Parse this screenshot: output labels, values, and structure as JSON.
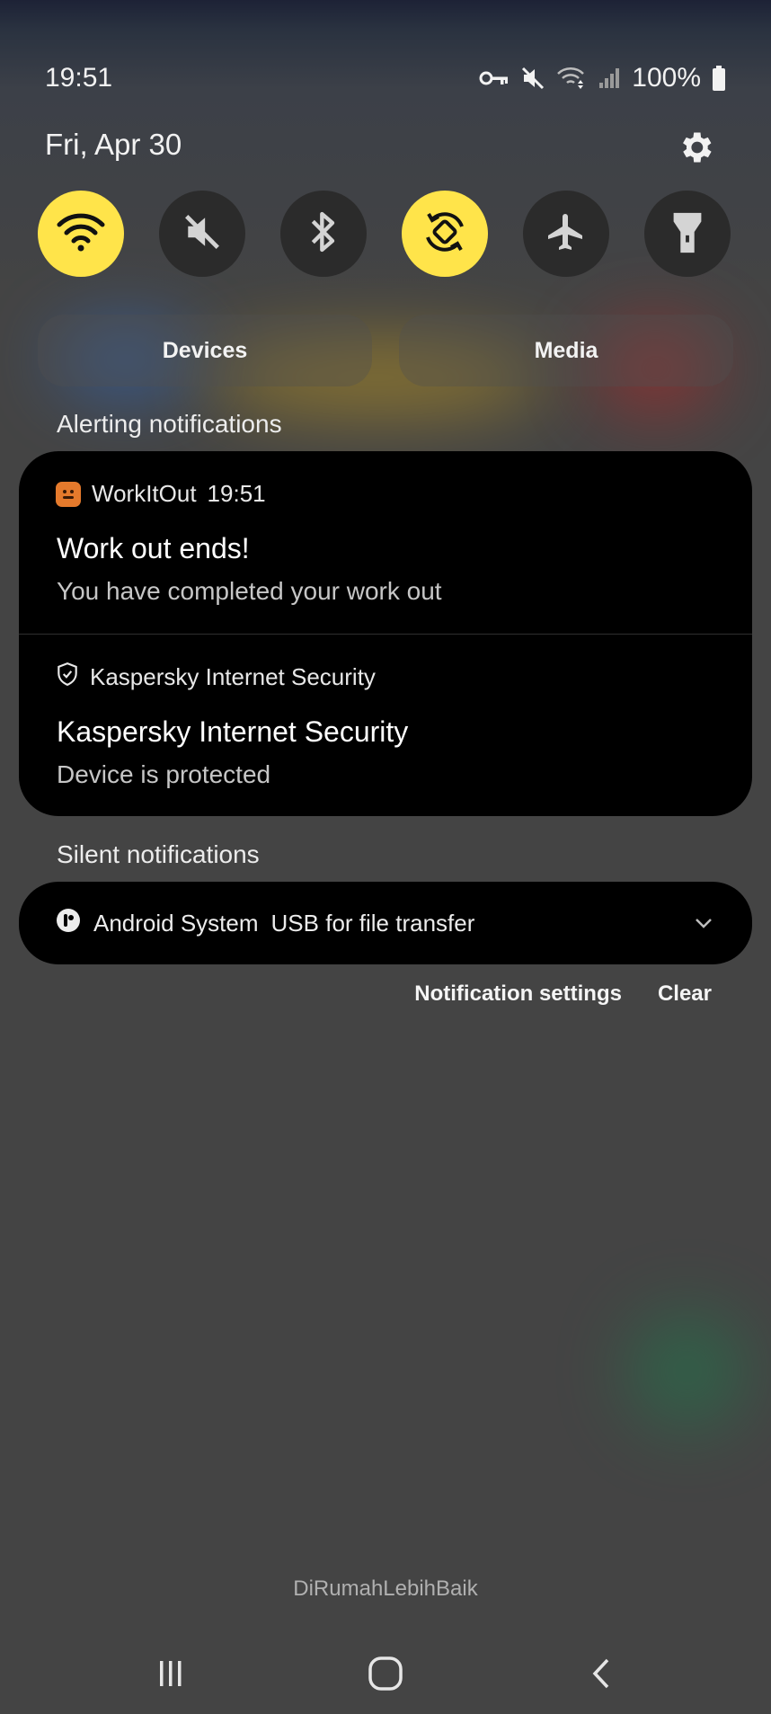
{
  "status_bar": {
    "time": "19:51",
    "battery": "100%",
    "icons": [
      "key-icon",
      "mute-icon",
      "wifi-data-icon",
      "signal-icon",
      "battery-icon"
    ]
  },
  "header": {
    "date": "Fri, Apr 30"
  },
  "quick_settings": [
    {
      "name": "wifi",
      "icon": "wifi-icon",
      "on": true
    },
    {
      "name": "sound",
      "icon": "mute-icon",
      "on": false
    },
    {
      "name": "bluetooth",
      "icon": "bluetooth-icon",
      "on": false
    },
    {
      "name": "auto-rotate",
      "icon": "rotate-icon",
      "on": true
    },
    {
      "name": "airplane",
      "icon": "airplane-icon",
      "on": false
    },
    {
      "name": "flashlight",
      "icon": "flashlight-icon",
      "on": false
    }
  ],
  "panel_buttons": {
    "devices": "Devices",
    "media": "Media"
  },
  "alerting": {
    "label": "Alerting notifications",
    "items": [
      {
        "app": "WorkItOut",
        "time": "19:51",
        "title": "Work out ends!",
        "body": "You have completed your work out"
      },
      {
        "app": "Kaspersky Internet Security",
        "title": "Kaspersky Internet Security",
        "body": "Device is protected"
      }
    ]
  },
  "silent": {
    "label": "Silent notifications",
    "app": "Android System",
    "text": "USB for file transfer"
  },
  "actions": {
    "notification_settings": "Notification settings",
    "clear": "Clear"
  },
  "watermark": "DiRumahLebihBaik",
  "colors": {
    "accent_on": "#ffe44a",
    "tile_off": "#2b2b2b",
    "card_bg": "#000000",
    "workitout_icon": "#e57a2c"
  }
}
